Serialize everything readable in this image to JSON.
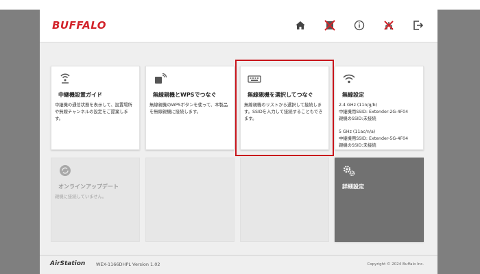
{
  "header": {
    "logo": "BUFFALO",
    "nav": [
      {
        "name": "home-icon"
      },
      {
        "name": "wireless-status-icon"
      },
      {
        "name": "info-icon"
      },
      {
        "name": "lan-status-icon"
      },
      {
        "name": "logout-icon"
      }
    ]
  },
  "cards": [
    {
      "title": "中継機設置ガイド",
      "desc": "中継機の通信状態を表示して、設置場所や無線チャンネルの設定をご提案します。",
      "icon": "signal-guide-icon"
    },
    {
      "title": "無線親機とWPSでつなぐ",
      "desc": "無線親機のWPSボタンを使って、本製品を無線親機に接続します。",
      "icon": "wps-device-icon"
    },
    {
      "title": "無線親機を選択してつなぐ",
      "desc": "無線親機のリストから選択して接続します。SSIDを入力して接続することもできます。",
      "icon": "keyboard-icon"
    },
    {
      "title": "無線設定",
      "icon": "wifi-icon",
      "band24": {
        "label": "2.4 GHz (11n/g/b)",
        "ssid": "中継機用SSID: Extender-2G-4F04",
        "parent": "親機のSSID:未接続"
      },
      "band5": {
        "label": "5 GHz (11ac/n/a)",
        "ssid": "中継機用SSID: Extender-5G-4F04",
        "parent": "親機のSSID:未接続"
      }
    },
    {
      "title": "オンラインアップデート",
      "desc": "親機に接続していません。",
      "icon": "update-icon"
    },
    {
      "title": "詳細設定",
      "icon": "gears-icon"
    }
  ],
  "footer": {
    "brand": "AirStation",
    "model": "WEX-1166DHPL Version 1.02",
    "copyright": "Copyright © 2024 Buffalo Inc."
  },
  "colors": {
    "brand": "#d2232a",
    "highlight": "#c8141b",
    "dark_card": "#717171"
  }
}
